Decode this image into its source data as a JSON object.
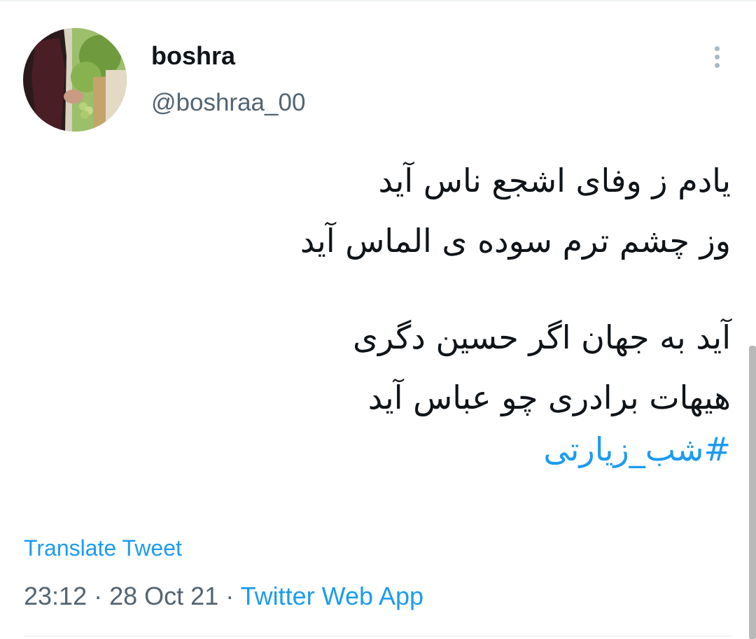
{
  "tweet": {
    "author": {
      "display_name": "boshra",
      "handle": "@boshraa_00"
    },
    "more_icon": "more-vertical-icon",
    "verses": [
      "یادم ز وفای اشجع ناس آید",
      "وز چشم ترم سوده ی الماس آید",
      "آید به جهان اگر حسین دگری",
      "هیهات برادری چو عباس آید"
    ],
    "hashtag": "#شب_زیارتی",
    "translate_label": "Translate Tweet",
    "time": "23:12",
    "date": "28 Oct 21",
    "separator": "·",
    "source": "Twitter Web App"
  },
  "colors": {
    "link": "#1d9bf0",
    "secondary_text": "#536471",
    "primary_text": "#0f1419",
    "divider": "#eff3f4"
  }
}
